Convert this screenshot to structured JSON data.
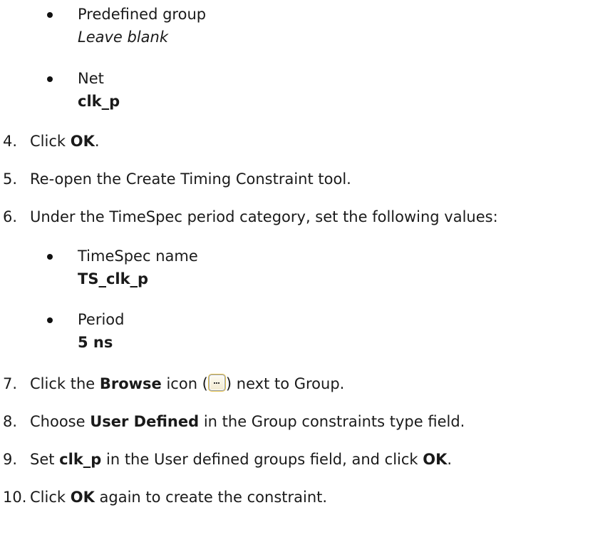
{
  "bullets_top": [
    {
      "label": "Predefined group",
      "value": "Leave blank",
      "value_style": "italic"
    },
    {
      "label": "Net",
      "value": "clk_p",
      "value_style": "bold"
    }
  ],
  "steps": {
    "s4": {
      "num": "4.",
      "pre": "Click ",
      "bold": "OK",
      "post": "."
    },
    "s5": {
      "num": "5.",
      "text": "Re-open the Create Timing Constraint tool."
    },
    "s6": {
      "num": "6.",
      "text": "Under the TimeSpec period category, set the following values:"
    },
    "s7": {
      "num": "7.",
      "pre": "Click the ",
      "bold": "Browse",
      "mid": " icon (",
      "post": ") next to Group."
    },
    "s8": {
      "num": "8.",
      "pre": "Choose ",
      "bold": "User Defined",
      "post": " in the Group constraints type field."
    },
    "s9": {
      "num": "9.",
      "pre": "Set ",
      "bold": "clk_p",
      "mid": " in the User defined groups field, and click ",
      "bold2": "OK",
      "post": "."
    },
    "s10": {
      "num": "10.",
      "pre": "Click ",
      "bold": "OK",
      "post": " again to create the constraint."
    }
  },
  "bullets_step6": [
    {
      "label": "TimeSpec name",
      "value": "TS_clk_p",
      "value_style": "bold"
    },
    {
      "label": "Period",
      "value": "5 ns",
      "value_style": "bold"
    }
  ],
  "icons": {
    "browse": "browse-ellipsis-icon"
  }
}
